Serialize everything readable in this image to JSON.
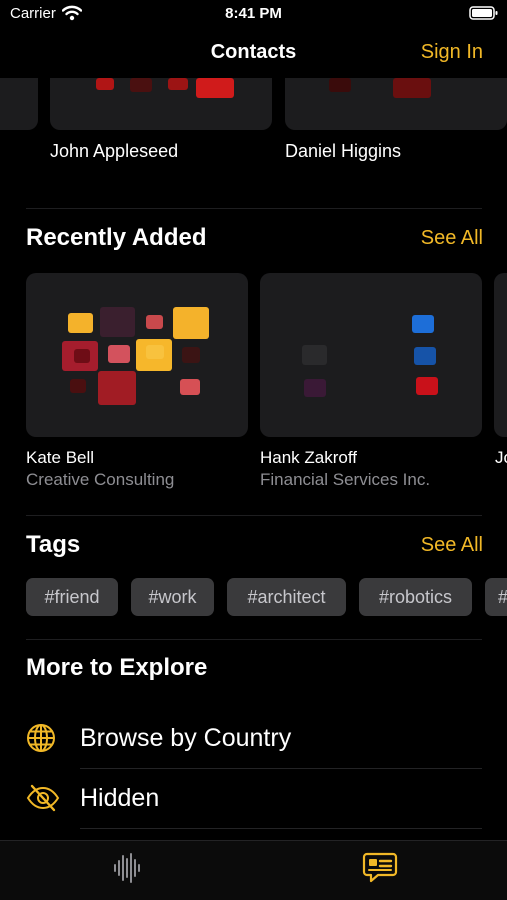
{
  "status_bar": {
    "carrier": "Carrier",
    "time": "8:41 PM"
  },
  "nav": {
    "title": "Contacts",
    "sign_in": "Sign In"
  },
  "favorites": [
    {
      "name": "John Appleseed"
    },
    {
      "name": "Daniel Higgins"
    }
  ],
  "recently_added": {
    "title": "Recently Added",
    "see_all": "See All",
    "contacts": [
      {
        "name": "Kate Bell",
        "company": "Creative Consulting"
      },
      {
        "name": "Hank Zakroff",
        "company": "Financial Services Inc."
      },
      {
        "name": "Jo"
      }
    ]
  },
  "tags": {
    "title": "Tags",
    "see_all": "See All",
    "items": [
      "#friend",
      "#work",
      "#architect",
      "#robotics",
      "#"
    ]
  },
  "explore": {
    "title": "More to Explore",
    "items": [
      {
        "label": "Browse by Country",
        "icon": "globe-icon"
      },
      {
        "label": "Hidden",
        "icon": "eye-slash-icon"
      }
    ]
  },
  "tab_bar": {
    "items": [
      {
        "icon": "waveform-icon"
      },
      {
        "icon": "contact-card-bubble-icon"
      }
    ]
  },
  "colors": {
    "accent": "#f1b827",
    "background": "#000000",
    "card": "#1c1c1e",
    "secondary_text": "#8e8e93",
    "tag_bg": "#3a3a3c"
  }
}
